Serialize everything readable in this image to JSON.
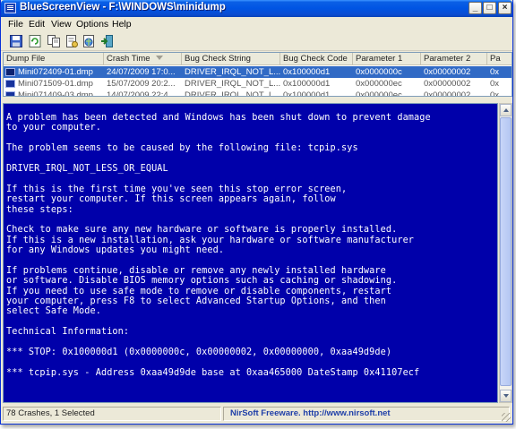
{
  "window": {
    "app_name": "BlueScreenView",
    "title": "BlueScreenView - F:\\WINDOWS\\minidump",
    "minimize_glyph": "_",
    "maximize_glyph": "□",
    "close_glyph": "×"
  },
  "menu": [
    "File",
    "Edit",
    "View",
    "Options",
    "Help"
  ],
  "toolbar": {
    "icons": [
      "save-icon",
      "refresh-icon",
      "copy-icon",
      "properties-icon",
      "html-report-icon",
      "exit-icon"
    ]
  },
  "table": {
    "columns": [
      "Dump File",
      "Crash Time",
      "Bug Check String",
      "Bug Check Code",
      "Parameter 1",
      "Parameter 2",
      "Pa"
    ],
    "rows": [
      [
        "Mini072409-01.dmp",
        "24/07/2009 17:0...",
        "DRIVER_IRQL_NOT_L...",
        "0x100000d1",
        "0x0000000c",
        "0x00000002",
        "0x"
      ],
      [
        "Mini071509-01.dmp",
        "15/07/2009 20:2...",
        "DRIVER_IRQL_NOT_L...",
        "0x100000d1",
        "0x000000ec",
        "0x00000002",
        "0x"
      ],
      [
        "Mini071409-03.dmp",
        "14/07/2009 22:4...",
        "DRIVER_IRQL_NOT_L...",
        "0x100000d1",
        "0x000000ec",
        "0x00000002",
        "0x"
      ]
    ],
    "selected_row": 0
  },
  "bsod": {
    "lines": [
      "A problem has been detected and Windows has been shut down to prevent damage",
      "to your computer.",
      "",
      "The problem seems to be caused by the following file: tcpip.sys",
      "",
      "DRIVER_IRQL_NOT_LESS_OR_EQUAL",
      "",
      "If this is the first time you've seen this stop error screen,",
      "restart your computer. If this screen appears again, follow",
      "these steps:",
      "",
      "Check to make sure any new hardware or software is properly installed.",
      "If this is a new installation, ask your hardware or software manufacturer",
      "for any Windows updates you might need.",
      "",
      "If problems continue, disable or remove any newly installed hardware",
      "or software. Disable BIOS memory options such as caching or shadowing.",
      "If you need to use safe mode to remove or disable components, restart",
      "your computer, press F8 to select Advanced Startup Options, and then",
      "select Safe Mode.",
      "",
      "Technical Information:",
      "",
      "*** STOP: 0x100000d1 (0x0000000c, 0x00000002, 0x00000000, 0xaa49d9de)",
      "",
      "*** tcpip.sys - Address 0xaa49d9de base at 0xaa465000 DateStamp 0x41107ecf"
    ]
  },
  "status": {
    "left": "78 Crashes, 1 Selected",
    "right": "NirSoft Freeware.  http://www.nirsoft.net"
  },
  "colors": {
    "bsod_background": "#0000aa",
    "selection": "#316ac5",
    "titlebar": "#0054e3"
  }
}
